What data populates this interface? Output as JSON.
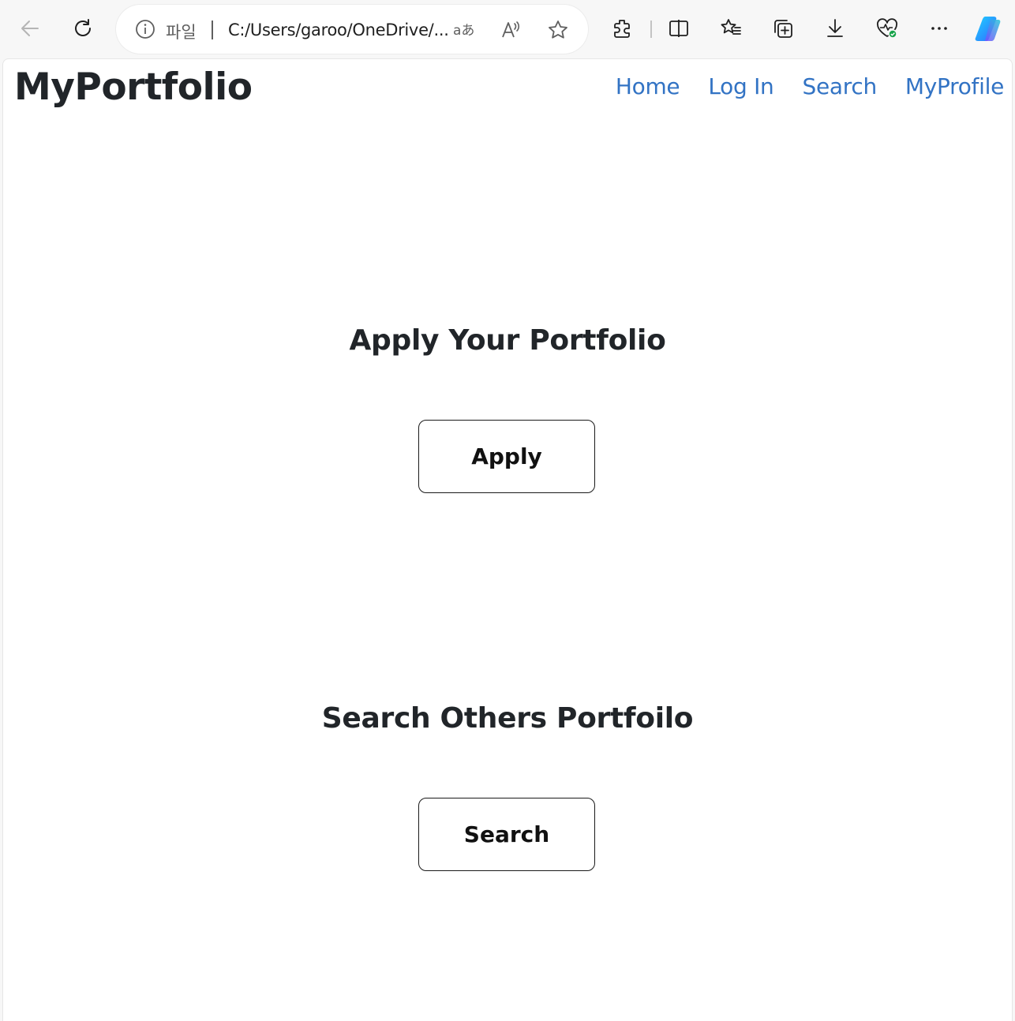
{
  "browser": {
    "address_bar": {
      "scheme_label": "파일",
      "url": "C:/Users/garoo/OneDrive/..."
    },
    "toolbar_icons": [
      "back-icon",
      "refresh-icon",
      "info-icon",
      "translate-icon",
      "read-aloud-icon",
      "favorite-star-icon",
      "extensions-icon",
      "split-screen-icon",
      "favorites-icon",
      "collections-icon",
      "downloads-icon",
      "browser-essentials-icon",
      "more-icon",
      "copilot-icon"
    ]
  },
  "header": {
    "brand": "MyPortfolio",
    "nav": [
      {
        "label": "Home"
      },
      {
        "label": "Log In"
      },
      {
        "label": "Search"
      },
      {
        "label": "MyProfile"
      }
    ]
  },
  "main": {
    "apply_section": {
      "title": "Apply Your Portfolio",
      "button_label": "Apply"
    },
    "search_section": {
      "title": "Search Others Portfoilo",
      "button_label": "Search"
    }
  },
  "colors": {
    "nav_link": "#3273c4",
    "heading": "#212529",
    "copilot_a": "#1fb6ff",
    "copilot_b": "#2f6bff"
  }
}
